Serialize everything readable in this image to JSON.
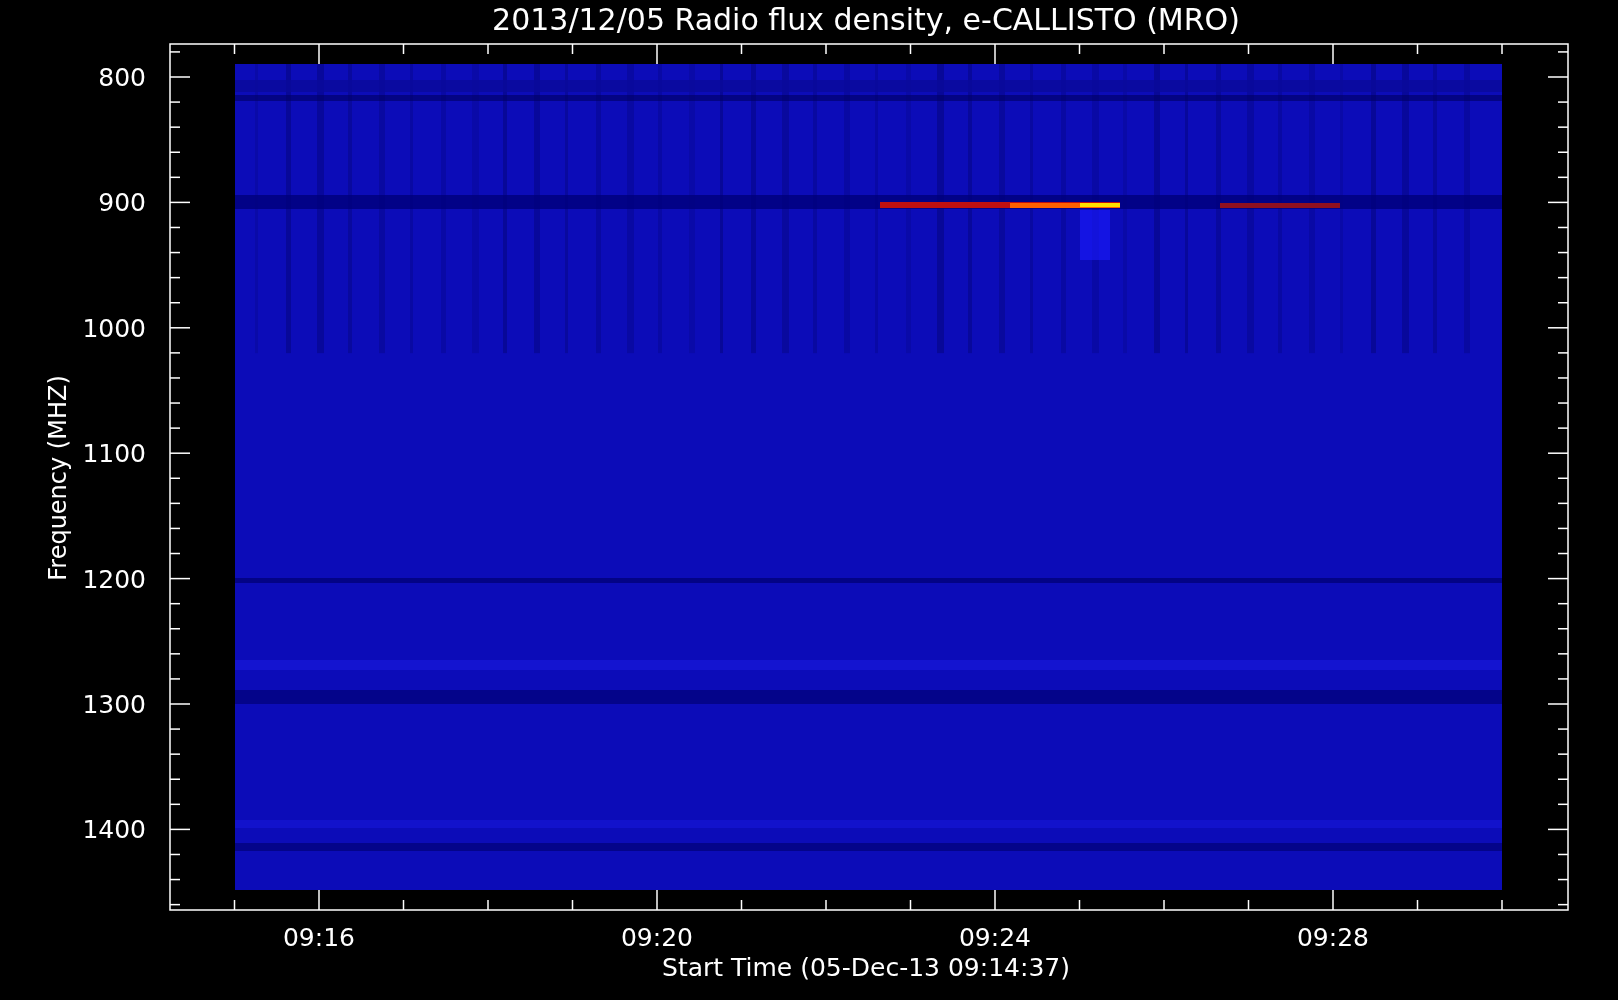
{
  "title": "2013/12/05  Radio flux density, e-CALLISTO (MRO)",
  "y_axis": {
    "label": "Frequency (MHZ)",
    "ticks": [
      "800",
      "900",
      "1000",
      "1100",
      "1200",
      "1300",
      "1400"
    ]
  },
  "x_axis": {
    "label": "Start Time (05-Dec-13 09:14:37)",
    "ticks": [
      "09:16",
      "09:20",
      "09:24",
      "09:28"
    ]
  }
}
